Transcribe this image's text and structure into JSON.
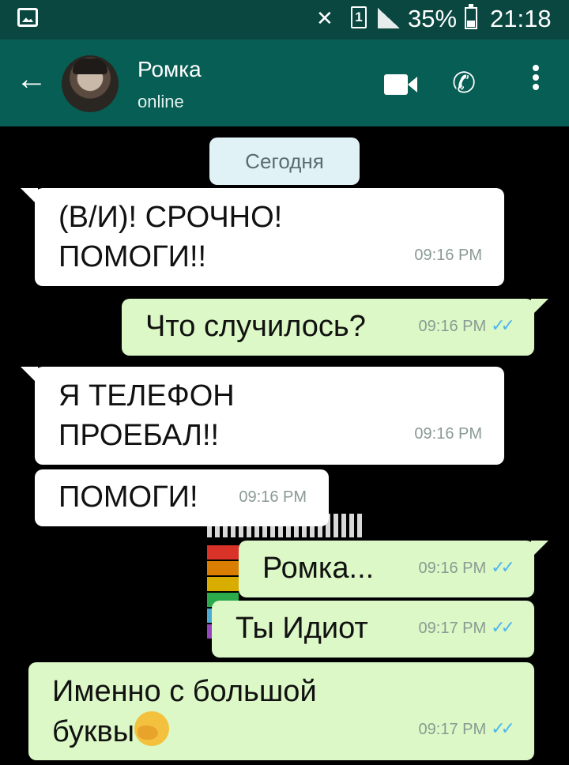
{
  "status_bar": {
    "battery_percent": "35%",
    "time": "21:18",
    "sim_number": "1"
  },
  "header": {
    "contact_name": "Ромка",
    "contact_status": "online"
  },
  "chat": {
    "date_chip": "Сегодня",
    "messages": [
      {
        "direction": "incoming",
        "lines": [
          "(В/И)! СРОЧНО!",
          "ПОМОГИ!!"
        ],
        "time": "09:16 PM"
      },
      {
        "direction": "outgoing",
        "lines": [
          "Что случилось?"
        ],
        "time": "09:16 PM",
        "read": true
      },
      {
        "direction": "incoming",
        "lines": [
          "Я ТЕЛЕФОН",
          "ПРОЕБАЛ!!"
        ],
        "time": "09:16 PM"
      },
      {
        "direction": "incoming",
        "lines": [
          "ПОМОГИ!"
        ],
        "time": "09:16 PM"
      },
      {
        "direction": "outgoing",
        "lines": [
          "Ромка..."
        ],
        "time": "09:16 PM",
        "read": true
      },
      {
        "direction": "outgoing",
        "lines": [
          "Ты Идиот"
        ],
        "time": "09:17 PM",
        "read": true
      },
      {
        "direction": "outgoing",
        "lines": [
          "Именно с большой",
          "буквы"
        ],
        "time": "09:17 PM",
        "read": true,
        "emoji": "facepalm-emoji"
      }
    ]
  },
  "colors": {
    "status_bar": "#0a4740",
    "header": "#075e54",
    "incoming_bubble": "#ffffff",
    "outgoing_bubble": "#dcf8c6",
    "read_ticks": "#4fb6ec"
  }
}
